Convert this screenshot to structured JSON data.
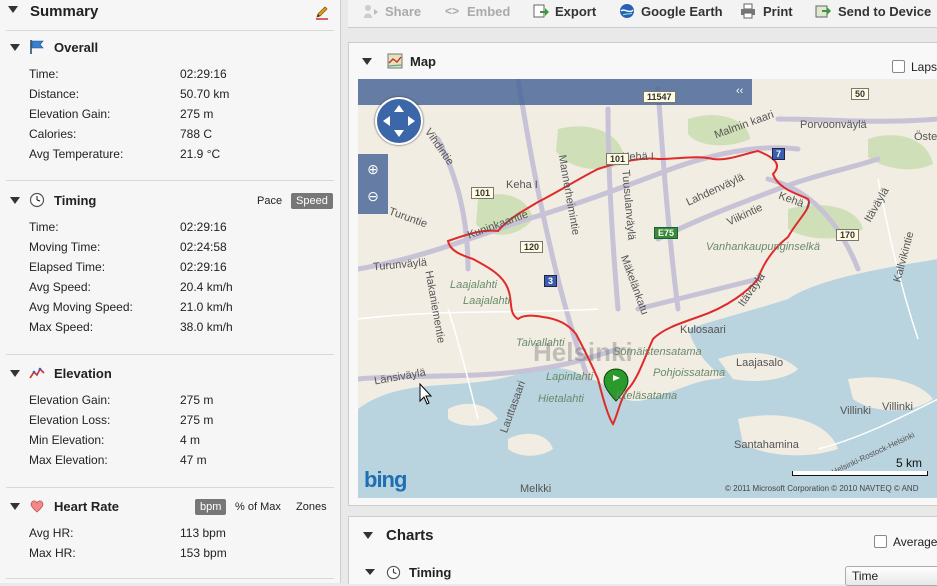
{
  "summary": {
    "title": "Summary",
    "overall": {
      "title": "Overall",
      "rows": [
        {
          "label": "Time:",
          "value": "02:29:16"
        },
        {
          "label": "Distance:",
          "value": "50.70 km"
        },
        {
          "label": "Elevation Gain:",
          "value": "275 m"
        },
        {
          "label": "Calories:",
          "value": "788 C"
        },
        {
          "label": "Avg Temperature:",
          "value": "21.9 °C"
        }
      ]
    },
    "timing": {
      "title": "Timing",
      "toggle_pace": "Pace",
      "toggle_speed": "Speed",
      "rows": [
        {
          "label": "Time:",
          "value": "02:29:16"
        },
        {
          "label": "Moving Time:",
          "value": "02:24:58"
        },
        {
          "label": "Elapsed Time:",
          "value": "02:29:16"
        },
        {
          "label": "Avg Speed:",
          "value": "20.4 km/h"
        },
        {
          "label": "Avg Moving Speed:",
          "value": "21.0 km/h"
        },
        {
          "label": "Max Speed:",
          "value": "38.0 km/h"
        }
      ]
    },
    "elevation": {
      "title": "Elevation",
      "rows": [
        {
          "label": "Elevation Gain:",
          "value": "275 m"
        },
        {
          "label": "Elevation Loss:",
          "value": "275 m"
        },
        {
          "label": "Min Elevation:",
          "value": "4 m"
        },
        {
          "label": "Max Elevation:",
          "value": "47 m"
        }
      ]
    },
    "heart_rate": {
      "title": "Heart Rate",
      "toggle_bpm": "bpm",
      "toggle_pct": "% of Max",
      "toggle_zones": "Zones",
      "rows": [
        {
          "label": "Avg HR:",
          "value": "113 bpm"
        },
        {
          "label": "Max HR:",
          "value": "153 bpm"
        }
      ]
    }
  },
  "toolbar": {
    "share": "Share",
    "embed": "Embed",
    "export": "Export",
    "google_earth": "Google Earth",
    "print": "Print",
    "send": "Send to Device"
  },
  "map": {
    "title": "Map",
    "laps_label": "Laps",
    "scale": "5 km",
    "copyright": "© 2011 Microsoft Corporation   © 2010 NAVTEQ   © AND",
    "brand": "bing",
    "labels": {
      "vihdintie": "Vihdintie",
      "turuntie": "Turuntie",
      "turunvayla": "Turunväylä",
      "haapaniementie": "Hakaniementie",
      "laajalahti1": "Laajalahti",
      "laajalahti2": "Laajalahti",
      "kehaI_1": "Keha I",
      "kehaI_2": "Kehä I",
      "kehaI_3": "Kehä I",
      "tuusulanvayla": "Tuusulanväylä",
      "mannerheimint": "Mannerheimintie",
      "makelankatu": "Mäkelänkatu",
      "lahdenvayla": "Lahdenväylä",
      "viikintie": "Viikintie",
      "vanhankaupunginselka": "Vanhankaupunginselkä",
      "itavayla": "Itäväylä",
      "malmin": "Malmin kaari",
      "porvoonvayla": "Porvoonväylä",
      "itavayla2": "Itäväylä",
      "kalvinkatu": "Kallvikintie",
      "ostersundom": "Öste",
      "taivallahti": "Taivallahti",
      "lapinlahti": "Lapinlahti",
      "hietalahti": "Hietalahti",
      "helsinki": "Helsinki",
      "sornainen": "Sörnäistensatama",
      "pohjoissatama": "Pohjoissatama",
      "etelasatama": "Eteläsatama",
      "kulosaari": "Kulosaari",
      "laajasalo": "Laajasalo",
      "villinki1": "Villinki",
      "villinki2": "Villinki",
      "santahamina": "Santahamina",
      "lauttasaari": "Lauttasaari",
      "lansivayla": "Länsiväylä",
      "melkki": "Melkki",
      "kuninkaantie": "Kuninkaantie",
      "helsinki_rostock": "Helsinki-Rostock-Helsinki"
    },
    "shields": {
      "s101a": "101",
      "s101b": "101",
      "s120": "120",
      "s3": "3",
      "e75": "E75",
      "s7": "7",
      "s50": "50",
      "s170": "170",
      "s11547": "11547"
    }
  },
  "charts": {
    "title": "Charts",
    "average_label": "Average",
    "timing_label": "Timing",
    "select_value": "Time"
  }
}
